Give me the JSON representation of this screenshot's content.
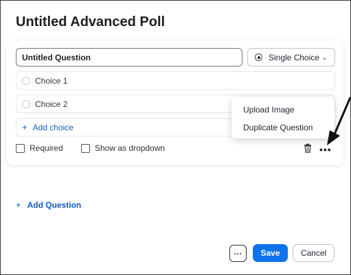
{
  "page": {
    "title": "Untitled Advanced Poll"
  },
  "question": {
    "input_value": "Untitled Question",
    "type_label": "Single Choice",
    "choices": [
      {
        "label": "Choice 1"
      },
      {
        "label": "Choice 2"
      }
    ],
    "add_choice_label": "Add choice",
    "required_label": "Required",
    "dropdown_label": "Show as dropdown"
  },
  "context_menu": {
    "items": [
      {
        "label": "Upload Image"
      },
      {
        "label": "Duplicate Question"
      }
    ]
  },
  "footer": {
    "add_question_label": "Add Question",
    "more_label": "···",
    "save_label": "Save",
    "cancel_label": "Cancel"
  },
  "colors": {
    "primary": "#0e72ed",
    "link": "#0e5cbf",
    "text": "#232333"
  },
  "icons": {
    "plus": "plus-icon",
    "trash": "trash-icon",
    "more": "more-options-icon",
    "chevron": "chevron-down-icon",
    "annotation_arrow": "arrow-icon"
  }
}
